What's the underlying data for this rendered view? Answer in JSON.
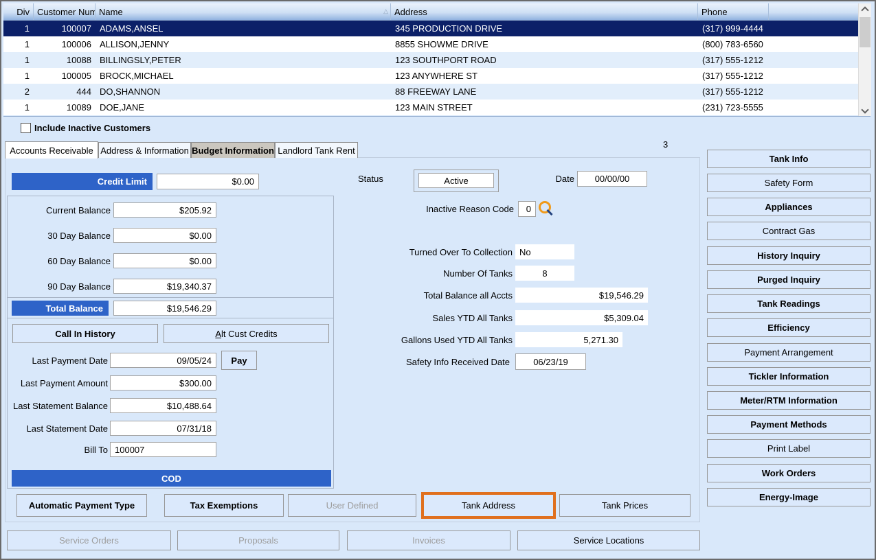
{
  "table": {
    "headers": {
      "div": "Div",
      "customer_number": "Customer Number",
      "name": "Name",
      "address": "Address",
      "phone": "Phone"
    },
    "rows": [
      {
        "div": "1",
        "customer_number": "100007",
        "name": "ADAMS,ANSEL",
        "address": "345 PRODUCTION DRIVE",
        "phone": "(317) 999-4444"
      },
      {
        "div": "1",
        "customer_number": "100006",
        "name": "ALLISON,JENNY",
        "address": "8855 SHOWME DRIVE",
        "phone": "(800) 783-6560"
      },
      {
        "div": "1",
        "customer_number": "10088",
        "name": "BILLINGSLY,PETER",
        "address": "123 SOUTHPORT ROAD",
        "phone": "(317) 555-1212"
      },
      {
        "div": "1",
        "customer_number": "100005",
        "name": "BROCK,MICHAEL",
        "address": "123 ANYWHERE ST",
        "phone": "(317) 555-1212"
      },
      {
        "div": "2",
        "customer_number": "444",
        "name": "DO,SHANNON",
        "address": "88 FREEWAY LANE",
        "phone": "(317) 555-1212"
      },
      {
        "div": "1",
        "customer_number": "10089",
        "name": "DOE,JANE",
        "address": "123 MAIN STREET",
        "phone": "(231) 723-5555"
      }
    ]
  },
  "include_inactive_label": "Include Inactive Customers",
  "record_count": "3",
  "tabs": [
    {
      "label": "Accounts Receivable"
    },
    {
      "label": "Address & Information"
    },
    {
      "label": "Budget Information"
    },
    {
      "label": "Landlord Tank Rent"
    }
  ],
  "ar": {
    "credit_limit_label": "Credit Limit",
    "credit_limit_value": "$0.00",
    "balances": [
      {
        "label": "Current Balance",
        "value": "$205.92"
      },
      {
        "label": "30 Day Balance",
        "value": "$0.00"
      },
      {
        "label": "60 Day Balance",
        "value": "$0.00"
      },
      {
        "label": "90 Day Balance",
        "value": "$19,340.37"
      }
    ],
    "total_balance_label": "Total Balance",
    "total_balance_value": "$19,546.29",
    "call_in_history": "Call In History",
    "alt_cust_credits_first": "A",
    "alt_cust_credits_rest": "lt Cust Credits",
    "pay": "Pay",
    "payments": [
      {
        "label": "Last Payment Date",
        "value": "09/05/24"
      },
      {
        "label": "Last Payment Amount",
        "value": "$300.00"
      },
      {
        "label": "Last Statement Balance",
        "value": "$10,488.64"
      },
      {
        "label": "Last Statement Date",
        "value": "07/31/18"
      }
    ],
    "bill_to_label": "Bill To",
    "bill_to_value": "100007",
    "cod": "COD",
    "status_label": "Status",
    "status_value": "Active",
    "date_label": "Date",
    "date_value": "00/00/00",
    "inactive_reason_label": "Inactive Reason Code",
    "inactive_reason_value": "0",
    "info": [
      {
        "label": "Turned Over To Collection",
        "value": "No"
      },
      {
        "label": "Number Of Tanks",
        "value": "8"
      },
      {
        "label": "Total Balance all Accts",
        "value": "$19,546.29"
      },
      {
        "label": "Sales YTD All Tanks",
        "value": "$5,309.04"
      },
      {
        "label": "Gallons Used YTD All Tanks",
        "value": "5,271.30"
      }
    ],
    "safety_label": "Safety Info Received Date",
    "safety_value": "06/23/19"
  },
  "side_buttons": [
    {
      "label": "Tank Info"
    },
    {
      "label": "Safety Form"
    },
    {
      "label": "Appliances"
    },
    {
      "label": "Contract Gas"
    },
    {
      "label": "History Inquiry"
    },
    {
      "label": "Purged Inquiry"
    },
    {
      "label": "Tank Readings"
    },
    {
      "label": "Efficiency"
    },
    {
      "label": "Payment Arrangement"
    },
    {
      "label": "Tickler Information"
    },
    {
      "label": "Meter/RTM Information"
    },
    {
      "label": "Payment Methods"
    },
    {
      "label": "Print Label"
    },
    {
      "label": "Work Orders"
    },
    {
      "label": "Energy-Image"
    }
  ],
  "bottom_row1": [
    {
      "label": "Automatic Payment Type"
    },
    {
      "label": "Tax Exemptions"
    },
    {
      "label": "User Defined"
    },
    {
      "label": "Tank Address"
    },
    {
      "label": "Tank Prices"
    }
  ],
  "bottom_row2": [
    {
      "label": "Service Orders"
    },
    {
      "label": "Proposals"
    },
    {
      "label": "Invoices"
    },
    {
      "label": "Service Locations"
    }
  ],
  "colors": {
    "accent_blue": "#2e63c8",
    "selected_row": "#0c2068",
    "highlight_orange": "#e0701e"
  }
}
